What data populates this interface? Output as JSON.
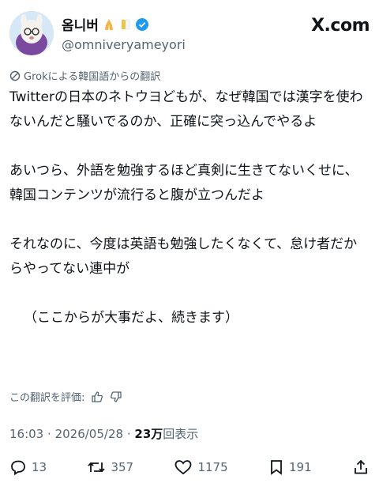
{
  "user": {
    "display_name": "옴니버",
    "handle": "@omniveryameyori",
    "icons": [
      "folded-hands-icon",
      "flag-icon",
      "verified-badge-icon"
    ]
  },
  "brand": {
    "label": "X.com"
  },
  "translation": {
    "label": "Grokによる韓国語からの翻訳"
  },
  "tweet": {
    "paragraphs": [
      "Twitterの日本のネトウヨどもが、なぜ韓国では漢字を使わないんだと騒いでるのか、正確に突っ込んでやるよ",
      "あいつら、外語を勉強するほど真剣に生きてないくせに、韓国コンテンツが流行ると腹が立つんだよ",
      "それなのに、今度は英語も勉強したくなくて、怠け者だからやってない連中が",
      "（ここからが大事だよ、続きます）"
    ]
  },
  "rating": {
    "label": "この翻訳を評価:"
  },
  "meta": {
    "time": "16:03",
    "date": "2026/05/28",
    "views_count": "23万",
    "views_label": "回表示",
    "separator": "·"
  },
  "actions": {
    "replies": "13",
    "reposts": "357",
    "likes": "1175",
    "bookmarks": "191"
  },
  "colors": {
    "text": "#0f1419",
    "secondary": "#536471",
    "verified": "#1d9bf0"
  }
}
